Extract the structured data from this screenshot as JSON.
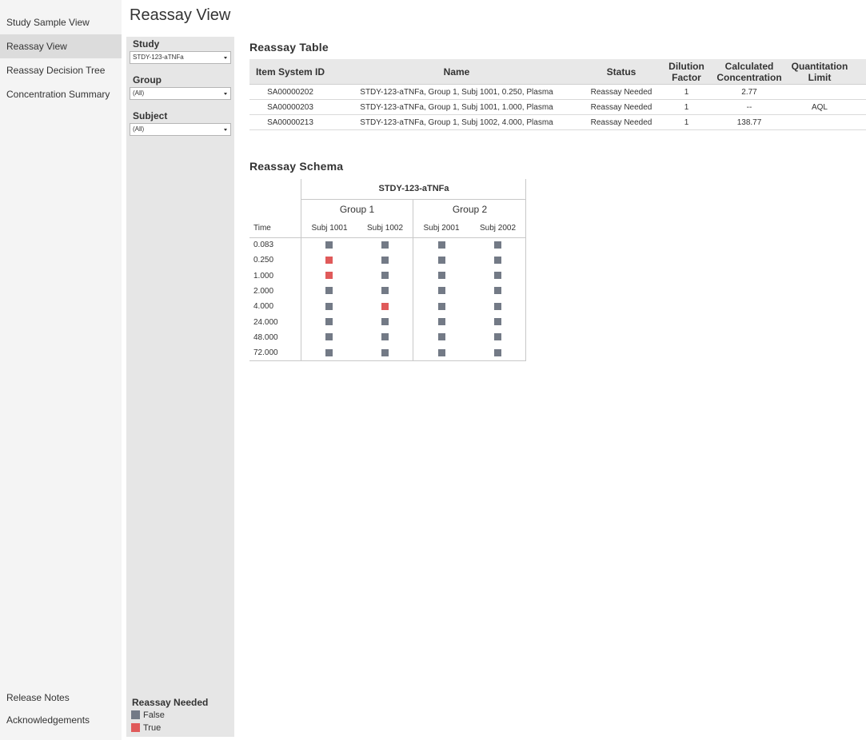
{
  "nav": {
    "items": [
      {
        "label": "Study Sample View",
        "active": false
      },
      {
        "label": "Reassay View",
        "active": true
      },
      {
        "label": "Reassay Decision Tree",
        "active": false
      },
      {
        "label": "Concentration Summary",
        "active": false
      }
    ],
    "footer": [
      {
        "label": "Release Notes"
      },
      {
        "label": "Acknowledgements"
      }
    ]
  },
  "page": {
    "title": "Reassay View"
  },
  "filters": {
    "study": {
      "label": "Study",
      "value": "STDY-123-aTNFa"
    },
    "group": {
      "label": "Group",
      "value": "(All)"
    },
    "subject": {
      "label": "Subject",
      "value": "(All)"
    }
  },
  "legend": {
    "title": "Reassay Needed",
    "items": [
      {
        "label": "False",
        "color": "#737a86"
      },
      {
        "label": "True",
        "color": "#e05a5a"
      }
    ]
  },
  "reassay_table": {
    "title": "Reassay Table",
    "headers": {
      "id": "Item System ID",
      "name": "Name",
      "status": "Status",
      "dilution_1": "Dilution",
      "dilution_2": "Factor",
      "calc_1": "Calculated",
      "calc_2": "Concentration",
      "quant_1": "Quantitation",
      "quant_2": "Limit"
    },
    "rows": [
      {
        "id": "SA00000202",
        "name": "STDY-123-aTNFa, Group 1, Subj 1001, 0.250, Plasma",
        "status": "Reassay Needed",
        "dilution": "1",
        "calc": "2.77",
        "quant": ""
      },
      {
        "id": "SA00000203",
        "name": "STDY-123-aTNFa, Group 1, Subj 1001, 1.000, Plasma",
        "status": "Reassay Needed",
        "dilution": "1",
        "calc": "--",
        "quant": "AQL"
      },
      {
        "id": "SA00000213",
        "name": "STDY-123-aTNFa, Group 1, Subj 1002, 4.000, Plasma",
        "status": "Reassay Needed",
        "dilution": "1",
        "calc": "138.77",
        "quant": ""
      }
    ]
  },
  "schema": {
    "title": "Reassay Schema",
    "study": "STDY-123-aTNFa",
    "time_label": "Time",
    "groups": [
      {
        "name": "Group 1",
        "subjects": [
          "Subj 1001",
          "Subj 1002"
        ]
      },
      {
        "name": "Group 2",
        "subjects": [
          "Subj 2001",
          "Subj 2002"
        ]
      }
    ],
    "times": [
      "0.083",
      "0.250",
      "1.000",
      "2.000",
      "4.000",
      "24.000",
      "48.000",
      "72.000"
    ],
    "matrix": [
      [
        false,
        false,
        false,
        false
      ],
      [
        true,
        false,
        false,
        false
      ],
      [
        true,
        false,
        false,
        false
      ],
      [
        false,
        false,
        false,
        false
      ],
      [
        false,
        true,
        false,
        false
      ],
      [
        false,
        false,
        false,
        false
      ],
      [
        false,
        false,
        false,
        false
      ],
      [
        false,
        false,
        false,
        false
      ]
    ]
  }
}
